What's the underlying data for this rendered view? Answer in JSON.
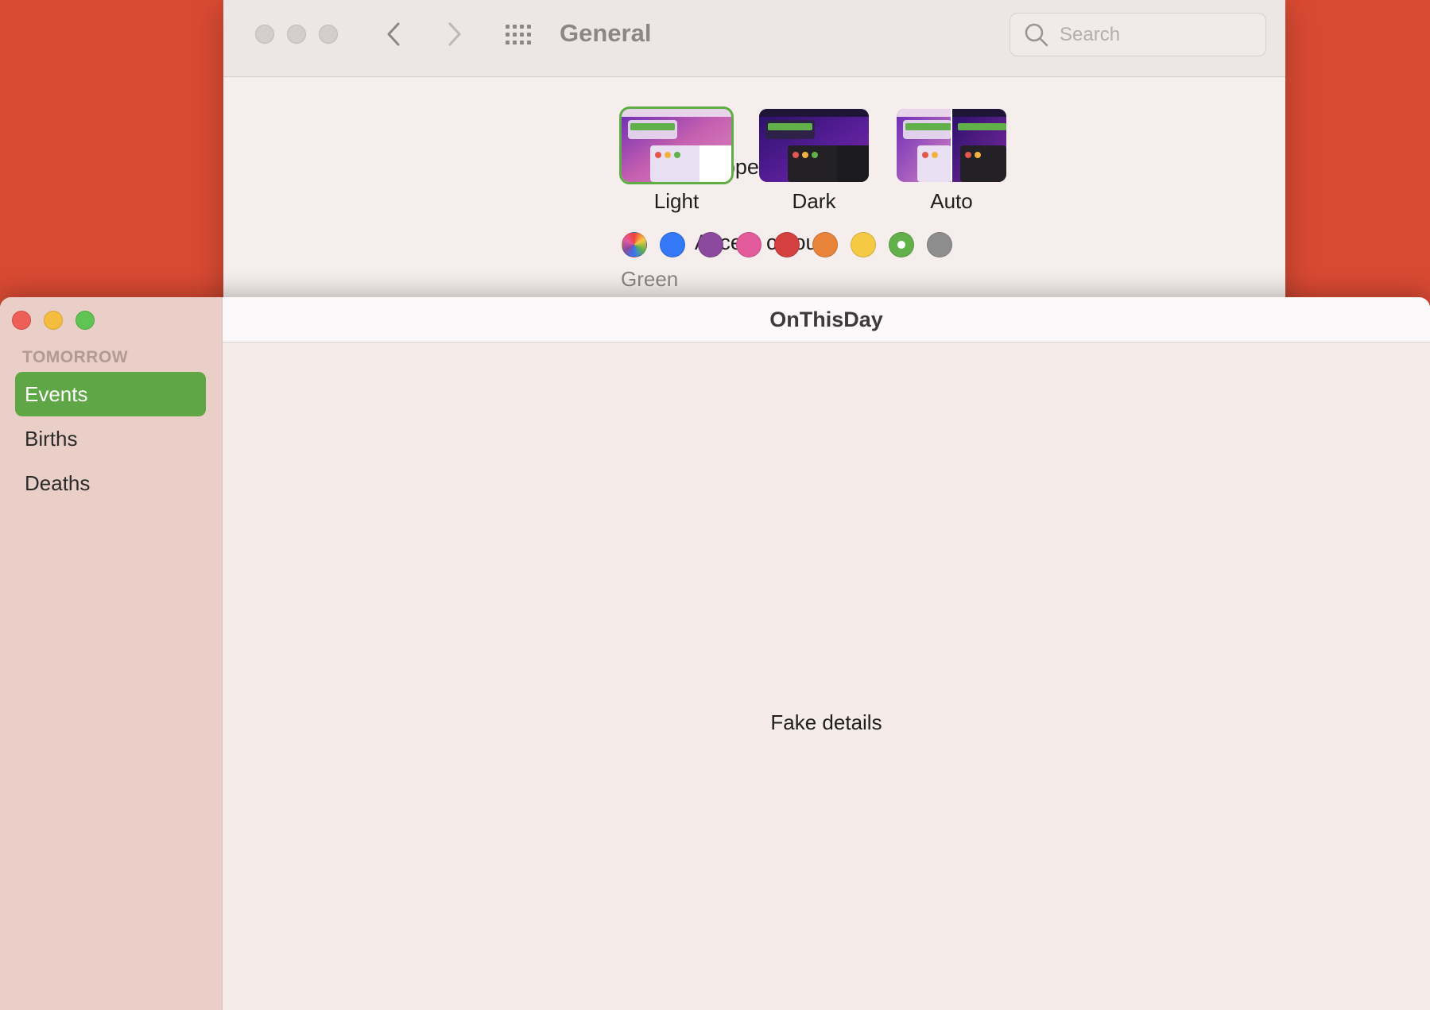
{
  "prefs": {
    "title": "General",
    "search_placeholder": "Search",
    "appearance_label": "Appearance:",
    "appearance_options": [
      "Light",
      "Dark",
      "Auto"
    ],
    "selected_appearance": "Light",
    "accent_label": "Accent colour:",
    "accent_colors": [
      "multicolor",
      "#3478f6",
      "#8b4a9e",
      "#e35a9b",
      "#d43f3f",
      "#e8843a",
      "#f6c944",
      "#62b04a",
      "#8e8e8e"
    ],
    "selected_accent_name": "Green"
  },
  "app": {
    "title": "OnThisDay",
    "sidebar_heading": "TOMORROW",
    "sidebar_items": [
      "Events",
      "Births",
      "Deaths"
    ],
    "selected_item": "Events",
    "detail_text": "Fake details"
  },
  "colors": {
    "background": "#d94a33",
    "accent_green": "#5fa647",
    "sidebar": "#e9cfc8"
  }
}
